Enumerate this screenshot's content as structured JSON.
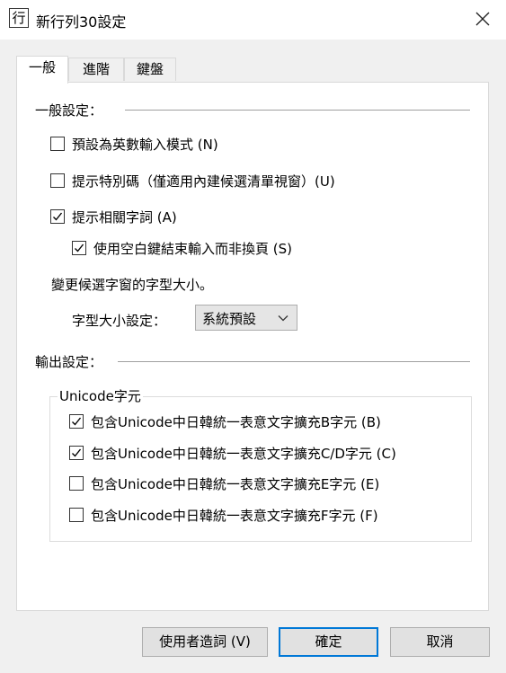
{
  "window": {
    "icon_glyph": "行",
    "title": "新行列30設定"
  },
  "tabs": [
    {
      "label": "一般",
      "active": true
    },
    {
      "label": "進階",
      "active": false
    },
    {
      "label": "鍵盤",
      "active": false
    }
  ],
  "general": {
    "section_title": "一般設定：",
    "options": [
      {
        "label": "預設為英數輸入模式 (N)",
        "checked": false
      },
      {
        "label": "提示特別碼（僅適用內建候選清單視窗）(U)",
        "checked": false
      },
      {
        "label": "提示相關字詞 (A)",
        "checked": true
      },
      {
        "label": "使用空白鍵結束輸入而非換頁 (S)",
        "checked": true
      }
    ],
    "font_size_desc": "變更候選字窗的字型大小。",
    "font_size_label": "字型大小設定：",
    "font_size_value": "系統預設"
  },
  "output": {
    "section_title": "輸出設定：",
    "unicode_legend": "Unicode字元",
    "options": [
      {
        "label": "包含Unicode中日韓統一表意文字擴充B字元 (B)",
        "checked": true
      },
      {
        "label": "包含Unicode中日韓統一表意文字擴充C/D字元 (C)",
        "checked": true
      },
      {
        "label": "包含Unicode中日韓統一表意文字擴充E字元 (E)",
        "checked": false
      },
      {
        "label": "包含Unicode中日韓統一表意文字擴充F字元 (F)",
        "checked": false
      }
    ]
  },
  "buttons": {
    "user_phrases": "使用者造詞 (V)",
    "ok": "確定",
    "cancel": "取消"
  },
  "colors": {
    "accent": "#0078d7",
    "dialog_bg": "#f0f0f0",
    "panel_bg": "#ffffff"
  }
}
